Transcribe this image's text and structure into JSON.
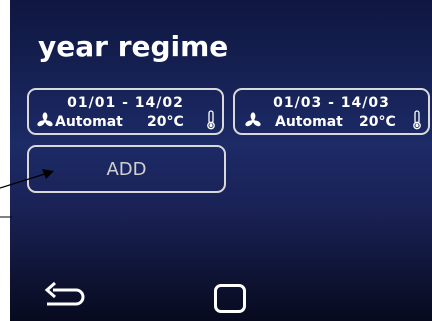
{
  "screen": {
    "title": "year regime"
  },
  "regimes": [
    {
      "date_range": "01/01 - 14/02",
      "mode": "Automat",
      "temperature": "20°C"
    },
    {
      "date_range": "01/03 - 14/03",
      "mode": "Automat",
      "temperature": "20°C"
    }
  ],
  "actions": {
    "add_label": "ADD"
  },
  "icons": {
    "card_left": "fan-icon",
    "card_right": "thermometer-icon",
    "nav_back": "back-arrow-icon",
    "nav_home": "home-square-icon"
  },
  "colors": {
    "background_top": "#0f1740",
    "background_mid": "#1c2a66",
    "background_bottom": "#070a1e",
    "border": "#d9d9d9",
    "text": "#ffffff"
  }
}
